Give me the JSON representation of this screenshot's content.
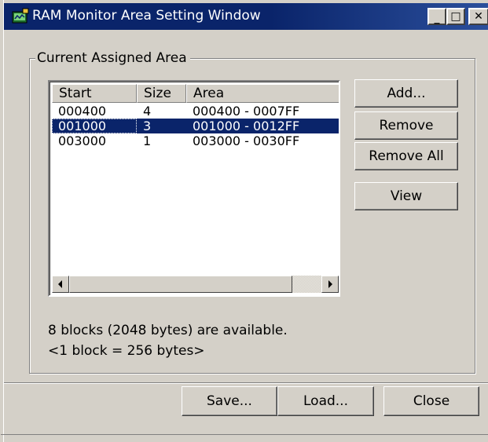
{
  "window": {
    "title": "RAM Monitor Area Setting Window",
    "minimize_glyph": "_",
    "maximize_glyph": "□",
    "close_glyph": "✕"
  },
  "group": {
    "label": "Current Assigned Area"
  },
  "list": {
    "columns": [
      "Start",
      "Size",
      "Area"
    ],
    "rows": [
      {
        "start": "000400",
        "size": "4",
        "area": "000400 - 0007FF",
        "selected": false
      },
      {
        "start": "001000",
        "size": "3",
        "area": "001000 - 0012FF",
        "selected": true
      },
      {
        "start": "003000",
        "size": "1",
        "area": "003000 - 0030FF",
        "selected": false
      }
    ]
  },
  "side_buttons": {
    "add": "Add...",
    "remove": "Remove",
    "remove_all": "Remove All",
    "view": "View"
  },
  "info": {
    "available": "8 blocks (2048 bytes) are available.",
    "block_size": "<1 block = 256 bytes>"
  },
  "bottom_buttons": {
    "save": "Save...",
    "load": "Load...",
    "close": "Close"
  },
  "colors": {
    "title_bar": "#0a246a",
    "selection": "#0a246a",
    "face": "#d4d0c8"
  },
  "icons": {
    "app": "ram-monitor-app-icon",
    "scroll_left": "arrow-left-icon",
    "scroll_right": "arrow-right-icon"
  }
}
